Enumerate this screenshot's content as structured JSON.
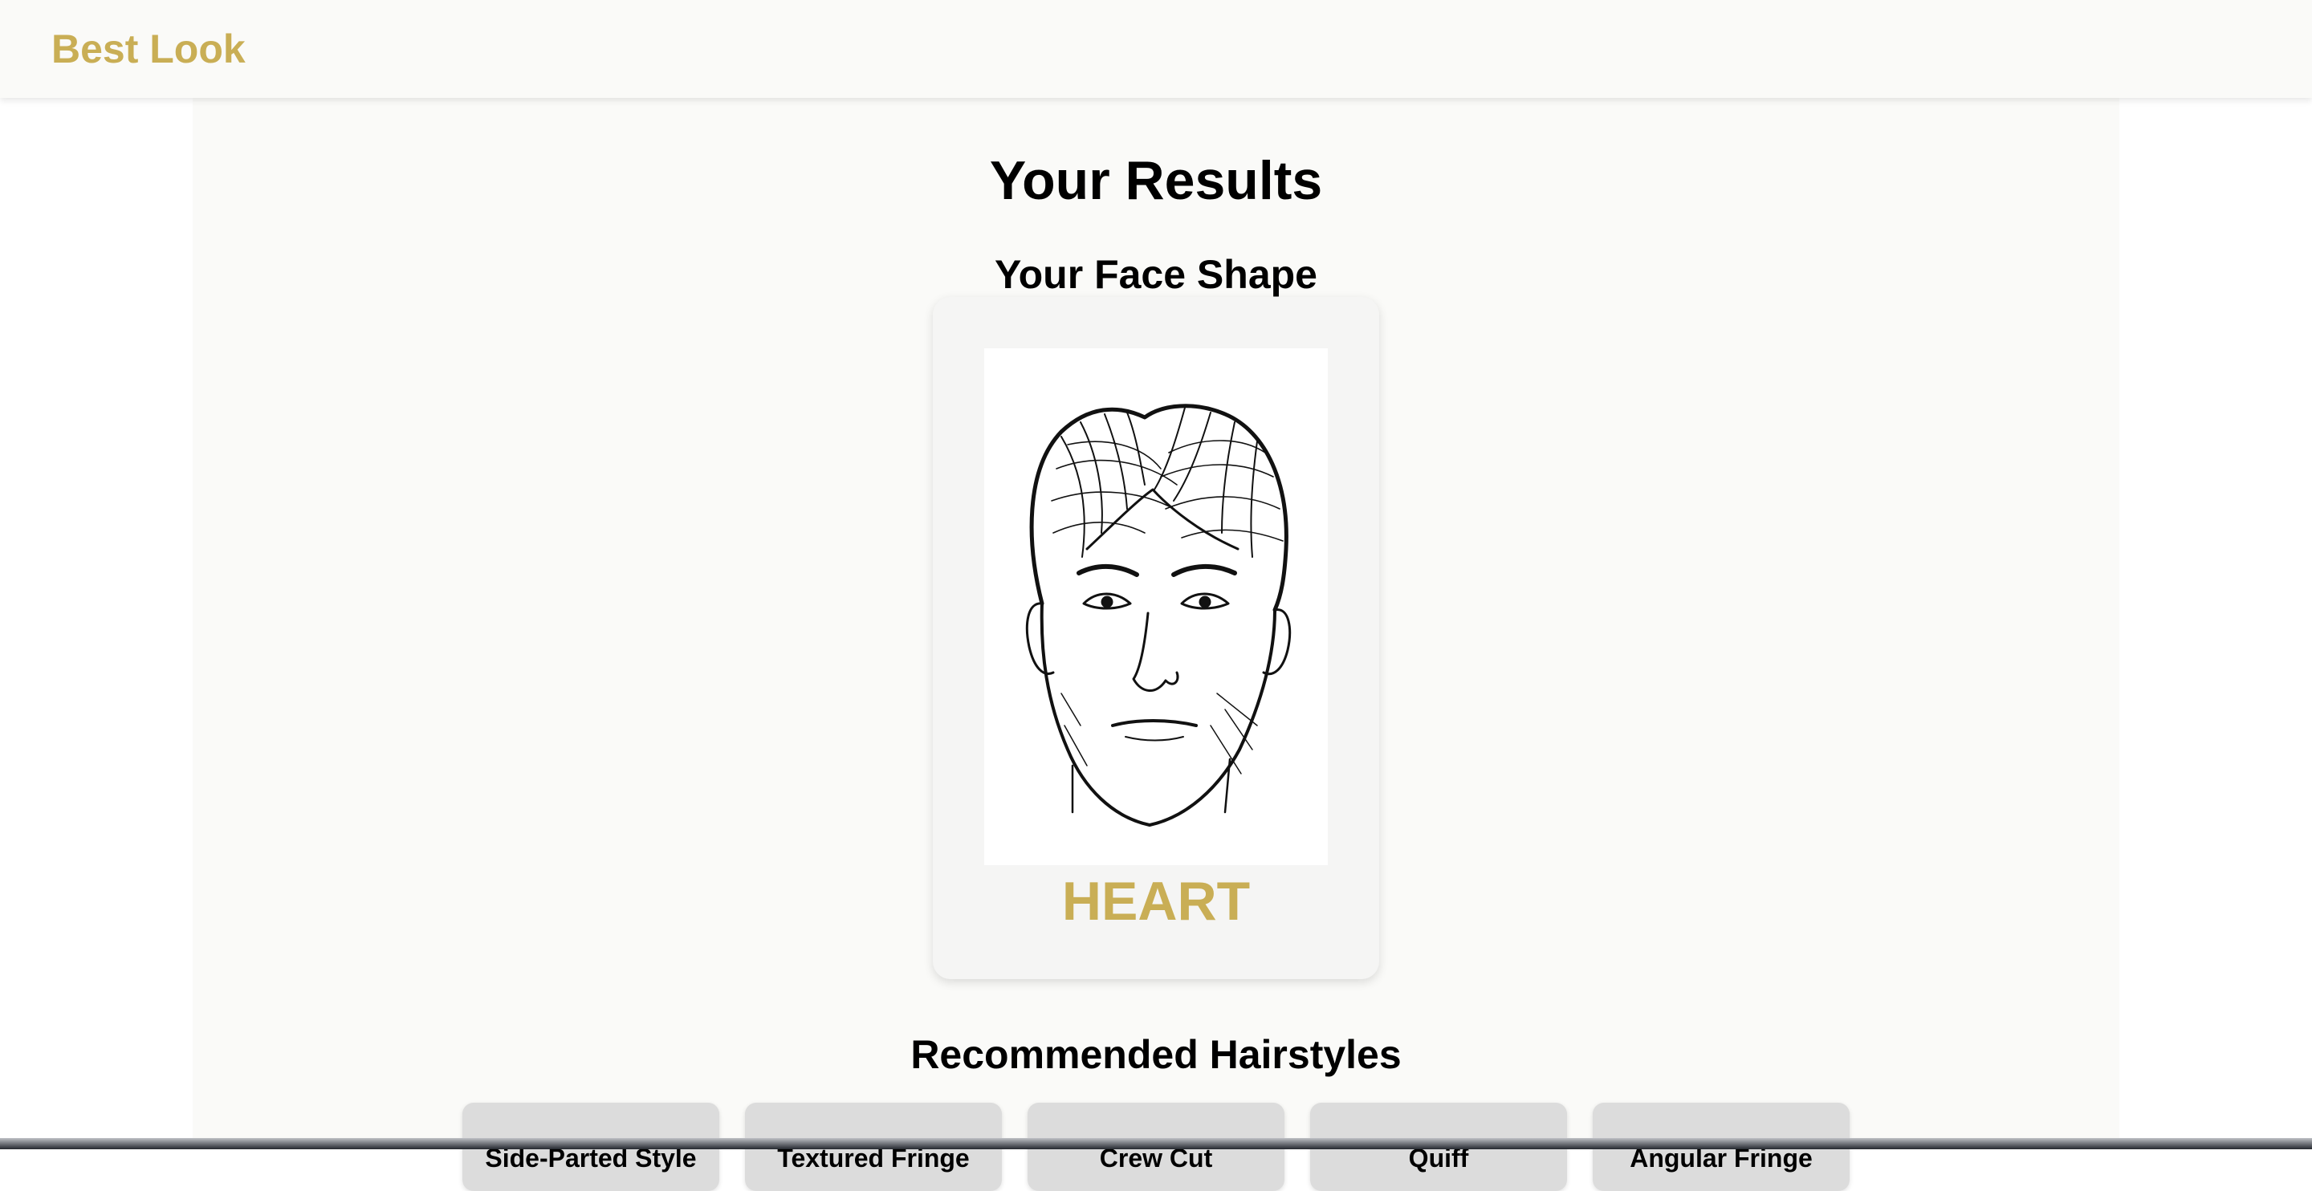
{
  "header": {
    "brand": "Best Look"
  },
  "main": {
    "page_title": "Your Results",
    "face_section_title": "Your Face Shape",
    "face_shape": "HEART",
    "recommended_title": "Recommended Hairstyles",
    "hairstyles": [
      "Side-Parted Style",
      "Textured Fringe",
      "Crew Cut",
      "Quiff",
      "Angular Fringe"
    ]
  },
  "colors": {
    "accent": "#c9ae55",
    "background": "#fafaf8",
    "card": "#f5f5f4",
    "button": "#dcdcdc"
  }
}
